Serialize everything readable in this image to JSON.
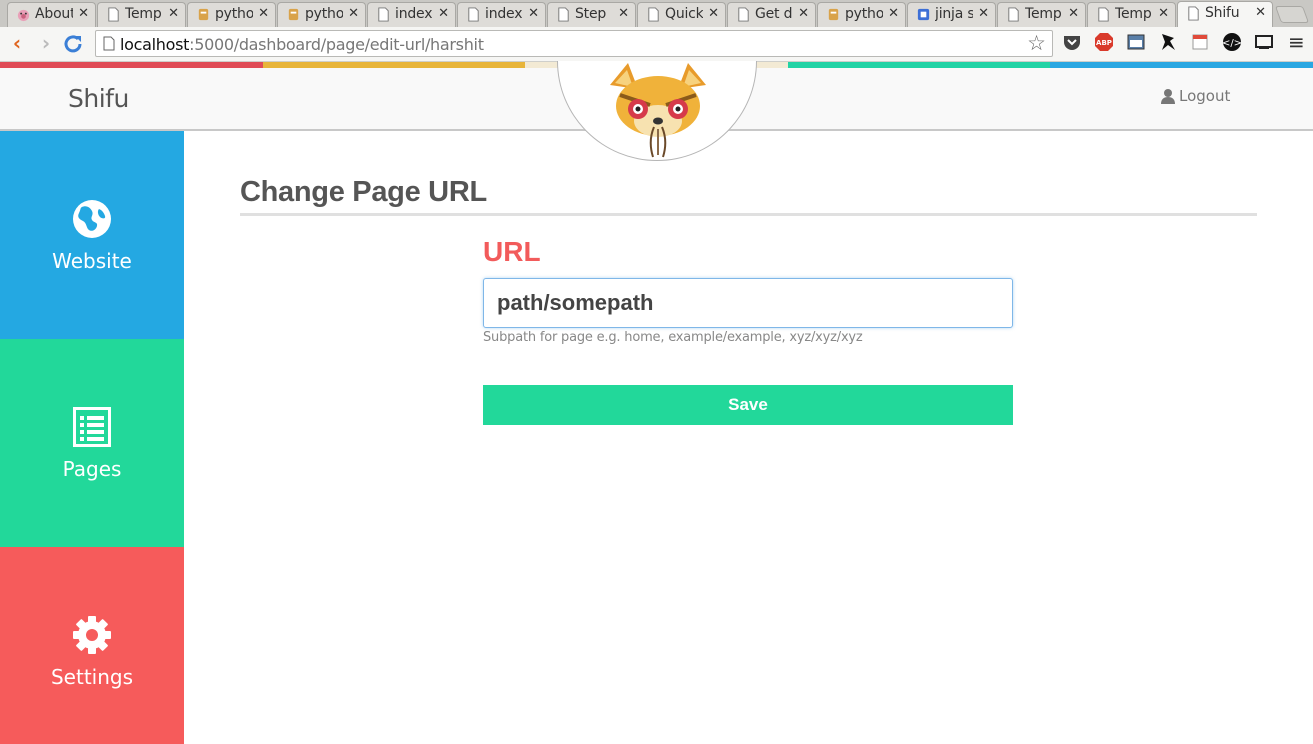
{
  "browser": {
    "tabs": [
      {
        "title": "About",
        "favicon": "pig-icon"
      },
      {
        "title": "Temp",
        "favicon": "document-icon"
      },
      {
        "title": "pytho",
        "favicon": "python-icon"
      },
      {
        "title": "pytho",
        "favicon": "python-icon"
      },
      {
        "title": "index",
        "favicon": "document-icon"
      },
      {
        "title": "index",
        "favicon": "document-icon"
      },
      {
        "title": "Step",
        "favicon": "document-icon"
      },
      {
        "title": "Quick",
        "favicon": "document-icon"
      },
      {
        "title": "Get d",
        "favicon": "document-icon"
      },
      {
        "title": "pytho",
        "favicon": "python-icon"
      },
      {
        "title": "jinja s",
        "favicon": "bookmark-icon"
      },
      {
        "title": "Temp",
        "favicon": "document-icon"
      },
      {
        "title": "Temp",
        "favicon": "document-icon"
      },
      {
        "title": "Shifu",
        "favicon": "document-icon",
        "active": true
      }
    ],
    "url_host": "localhost",
    "url_rest": ":5000/dashboard/page/edit-url/harshit"
  },
  "header": {
    "brand": "Shifu",
    "logout_label": "Logout",
    "band_colors": [
      "#e04b56",
      "#e8b53a",
      "#f3ead4",
      "#22d3a5",
      "#2aa7e2"
    ]
  },
  "sidebar": {
    "items": [
      {
        "label": "Website",
        "icon": "globe-icon",
        "color": "#24a8e2"
      },
      {
        "label": "Pages",
        "icon": "list-icon",
        "color": "#22d89a"
      },
      {
        "label": "Settings",
        "icon": "gear-icon",
        "color": "#f65b5b"
      }
    ]
  },
  "main": {
    "title": "Change Page URL",
    "field_label": "URL",
    "url_value": "path/somepath",
    "help_text": "Subpath for page e.g. home, example/example, xyz/xyz/xyz",
    "save_label": "Save"
  }
}
